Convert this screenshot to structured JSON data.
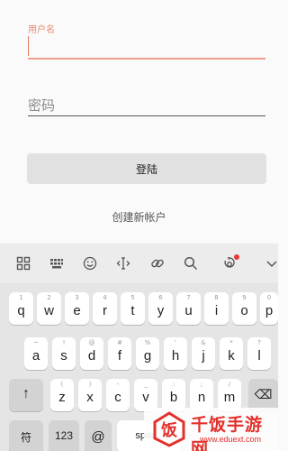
{
  "form": {
    "username_label": "用户名",
    "password_placeholder": "密码",
    "login_button": "登陆",
    "create_account": "创建新帐户"
  },
  "keyboard": {
    "toolbar_icons": [
      "grid-icon",
      "keyboard-icon",
      "emoji-icon",
      "text-cursor-icon",
      "link-icon",
      "search-icon",
      "voice-icon",
      "chevron-down-icon"
    ],
    "notification_color": "#e53935",
    "row1": [
      {
        "hint": "1",
        "key": "q"
      },
      {
        "hint": "2",
        "key": "w"
      },
      {
        "hint": "3",
        "key": "e"
      },
      {
        "hint": "4",
        "key": "r"
      },
      {
        "hint": "5",
        "key": "t"
      },
      {
        "hint": "6",
        "key": "y"
      },
      {
        "hint": "7",
        "key": "u"
      },
      {
        "hint": "8",
        "key": "i"
      },
      {
        "hint": "9",
        "key": "o"
      },
      {
        "hint": "0",
        "key": "p"
      }
    ],
    "row2": [
      {
        "hint": "~",
        "key": "a"
      },
      {
        "hint": "!",
        "key": "s"
      },
      {
        "hint": "@",
        "key": "d"
      },
      {
        "hint": "#",
        "key": "f"
      },
      {
        "hint": "%",
        "key": "g"
      },
      {
        "hint": "'",
        "key": "h"
      },
      {
        "hint": "&",
        "key": "j"
      },
      {
        "hint": "*",
        "key": "k"
      },
      {
        "hint": "?",
        "key": "l"
      }
    ],
    "row3": [
      {
        "hint": "(",
        "key": "z"
      },
      {
        "hint": ")",
        "key": "x"
      },
      {
        "hint": "-",
        "key": "c"
      },
      {
        "hint": "_",
        "key": "v"
      },
      {
        "hint": ":",
        "key": "b"
      },
      {
        "hint": ";",
        "key": "n"
      },
      {
        "hint": "/",
        "key": "m"
      }
    ],
    "shift_key": "↑",
    "backspace_key": "⌫",
    "symbol_key": "符",
    "numeric_key": "123",
    "at_key": "@",
    "space_key": "space"
  },
  "watermark": {
    "title": "千饭手游网",
    "url": "www.eduext.com",
    "logo_text": "饭",
    "color": "#e2312c"
  }
}
